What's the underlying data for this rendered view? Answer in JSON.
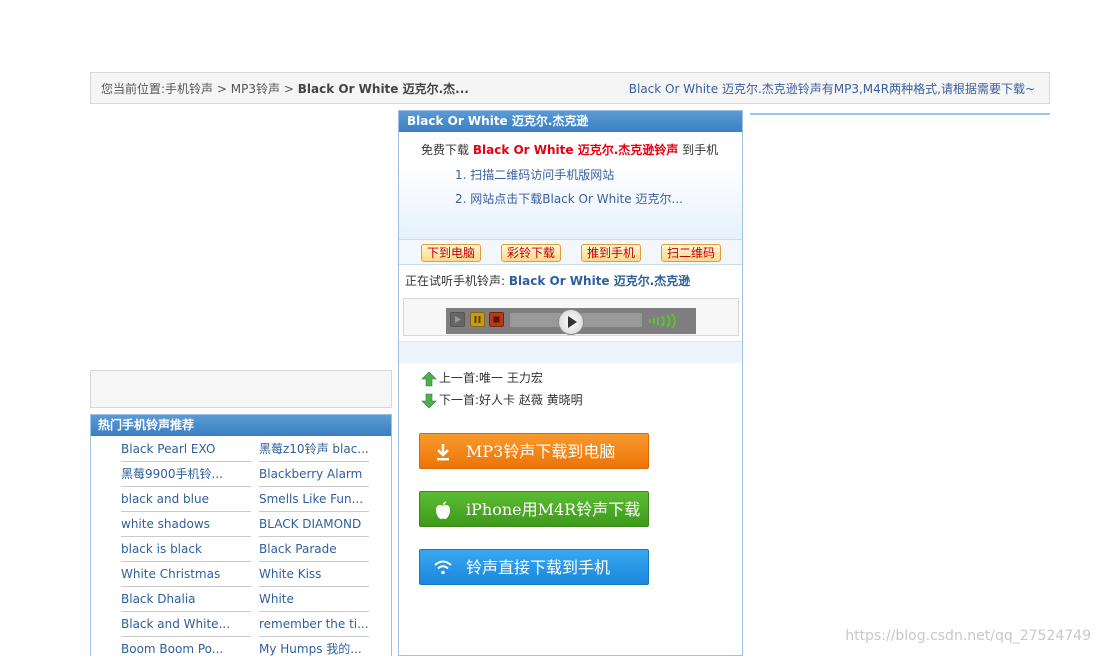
{
  "breadcrumb": {
    "prefix": "您当前位置:",
    "items": [
      "手机铃声",
      "MP3铃声"
    ],
    "separator": ">",
    "current": "Black Or White 迈克尔.杰...",
    "note": "Black Or White 迈克尔.杰克逊铃声有MP3,M4R两种格式,请根据需要下载~"
  },
  "hot": {
    "title": "热门手机铃声推荐",
    "rows": [
      [
        "Black Pearl EXO",
        "黑莓z10铃声 blac..."
      ],
      [
        "黑莓9900手机铃...",
        "Blackberry Alarm"
      ],
      [
        "black and blue",
        "Smells Like Fun..."
      ],
      [
        "white shadows",
        "BLACK DIAMOND"
      ],
      [
        "black is black",
        "Black Parade"
      ],
      [
        "White Christmas",
        "White Kiss"
      ],
      [
        "Black Dhalia",
        "White"
      ],
      [
        "Black and White...",
        "remember the ti..."
      ],
      [
        "Boom Boom Po...",
        "My Humps 我的..."
      ]
    ]
  },
  "song": {
    "title": "Black Or White 迈克尔.杰克逊",
    "free_prefix": "免费下载",
    "free_name": "Black Or White 迈克尔.杰克逊铃声",
    "free_suffix": "到手机",
    "step1": "1. 扫描二维码访问手机版网站",
    "step2": "2. 网站点击下载Black Or White 迈克尔...",
    "small_buttons": [
      "下到电脑",
      "彩铃下载",
      "推到手机",
      "扫二维码"
    ],
    "playing_prefix": "正在试听手机铃声:",
    "playing_name": "Black Or White 迈克尔.杰克逊",
    "prev_label": "上一首:",
    "prev_name": "唯一 王力宏",
    "next_label": "下一首:",
    "next_name": "好人卡 赵薇 黄晓明",
    "btn_mp3": "MP3铃声下载到电脑",
    "btn_iphone": "iPhone用M4R铃声下载",
    "btn_phone": "铃声直接下载到手机"
  },
  "colors": {
    "accent_blue": "#3a7fc3",
    "orange_btn": "#f07d13",
    "green_btn": "#4aa626",
    "blue_btn": "#2596e6",
    "red_text": "#e60012"
  },
  "watermark": "https://blog.csdn.net/qq_27524749"
}
